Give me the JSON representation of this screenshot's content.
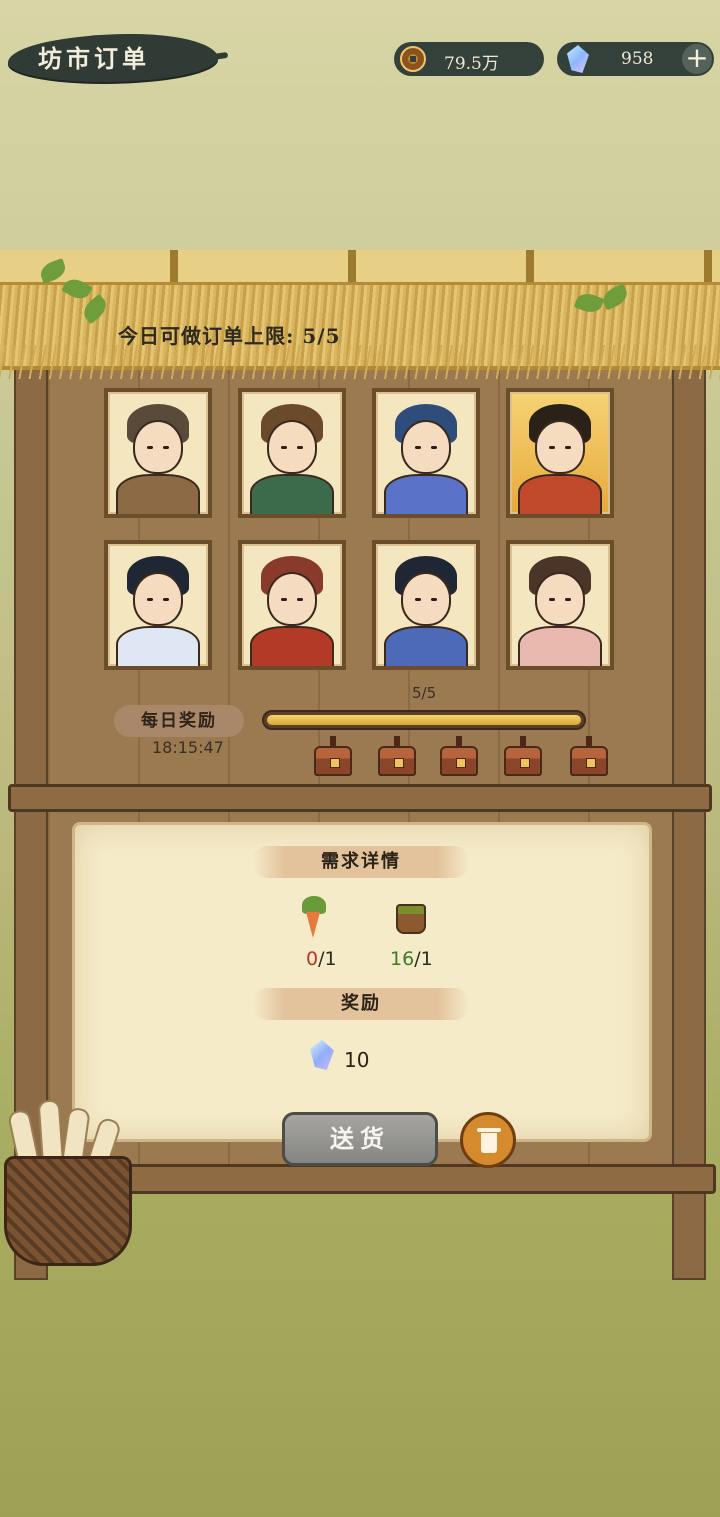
{
  "header": {
    "title": "坊市订单",
    "coins": "79.5万",
    "gems": "958",
    "add_label": "+"
  },
  "orders": {
    "limit_text": "今日可做订单上限: 5/5",
    "cards": [
      {
        "name": "villager-old-man",
        "hair": "#5a4a3a",
        "robe": "#8b6a45"
      },
      {
        "name": "masked-merchant",
        "hair": "#6a4a2a",
        "robe": "#3b6b4a"
      },
      {
        "name": "blue-haired-lady",
        "hair": "#2f4d7a",
        "robe": "#5a72c8"
      },
      {
        "name": "official-with-abacus",
        "hair": "#2a2218",
        "robe": "#c0492b"
      },
      {
        "name": "young-disciple",
        "hair": "#1f2735",
        "robe": "#dfe7f4"
      },
      {
        "name": "boar-demon",
        "hair": "#8a3a2a",
        "robe": "#b23a26"
      },
      {
        "name": "swordsman",
        "hair": "#1f2735",
        "robe": "#4d6ab8"
      },
      {
        "name": "fan-girl",
        "hair": "#4a3528",
        "robe": "#e9b9b0"
      }
    ]
  },
  "daily_reward": {
    "label": "每日奖励",
    "timer": "18:15:47",
    "progress_text": "5/5",
    "progress": 1.0,
    "chest_count": 5
  },
  "requirements": {
    "title": "需求详情",
    "items": [
      {
        "icon": "carrot-icon",
        "have": "0",
        "need": "/1",
        "have_color": "#b13a2a"
      },
      {
        "icon": "bucket-icon",
        "have": "16",
        "need": "/1",
        "have_color": "#3d7a2a"
      }
    ]
  },
  "reward": {
    "title": "奖励",
    "icon": "gem-icon",
    "amount": "10"
  },
  "actions": {
    "deliver_label": "送货"
  }
}
